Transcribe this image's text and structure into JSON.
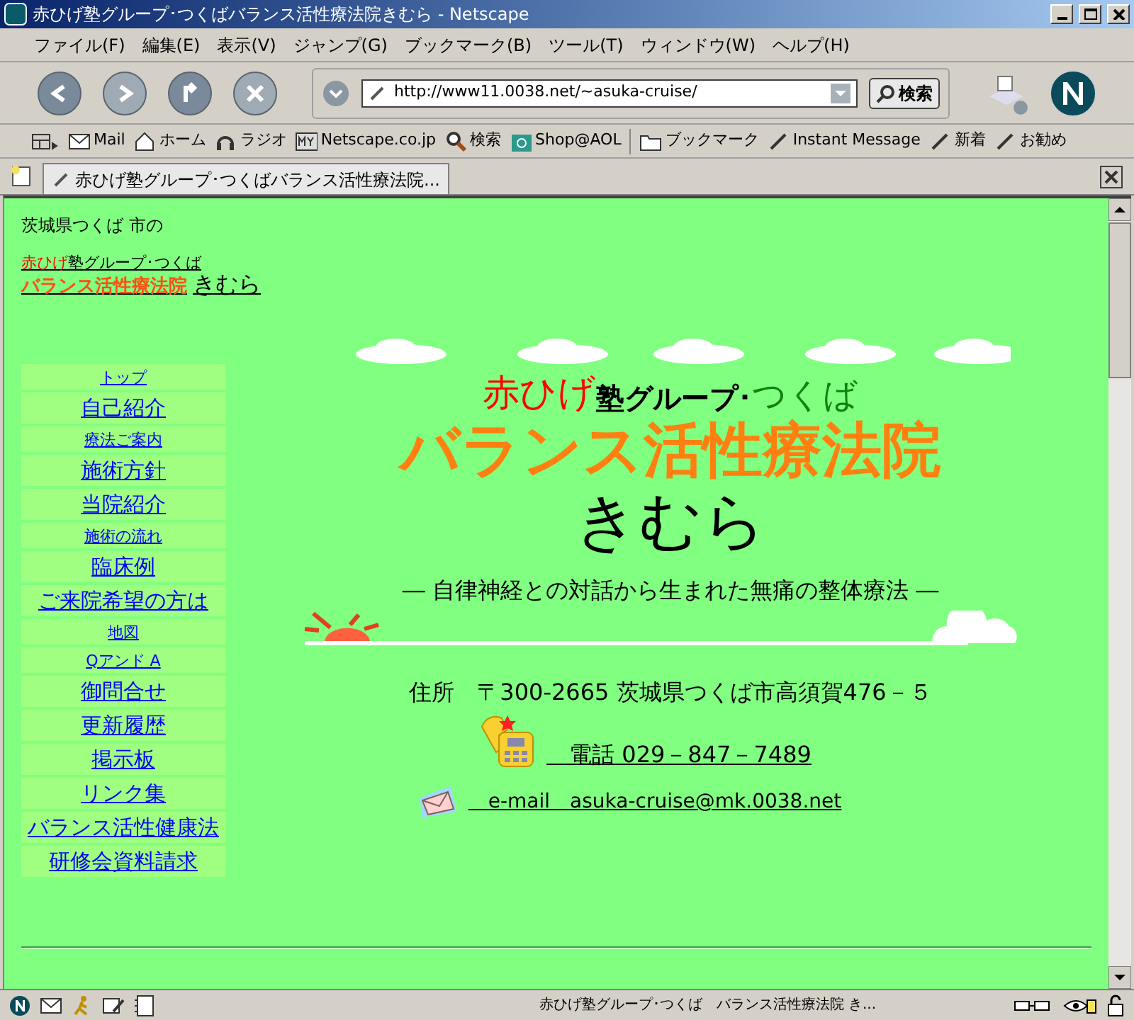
{
  "window": {
    "title": "赤ひげ塾グループ･つくばバランス活性療法院きむら - Netscape"
  },
  "menu": [
    "ファイル(F)",
    "編集(E)",
    "表示(V)",
    "ジャンプ(G)",
    "ブックマーク(B)",
    "ツール(T)",
    "ウィンドウ(W)",
    "ヘルプ(H)"
  ],
  "address": {
    "url": "http://www11.0038.net/~asuka-cruise/",
    "search_button": "検索"
  },
  "personal_toolbar": [
    {
      "kind": "mail",
      "label": "Mail"
    },
    {
      "kind": "home",
      "label": "ホーム"
    },
    {
      "kind": "radio",
      "label": "ラジオ"
    },
    {
      "kind": "my",
      "label": "Netscape.co.jp"
    },
    {
      "kind": "search",
      "label": "検索"
    },
    {
      "kind": "shop",
      "label": "Shop@AOL"
    },
    {
      "kind": "folder",
      "label": "ブックマーク"
    },
    {
      "kind": "bookmark",
      "label": "Instant Message"
    },
    {
      "kind": "bookmark",
      "label": "新着"
    },
    {
      "kind": "bookmark",
      "label": "お勧め"
    }
  ],
  "tab": {
    "title": "赤ひげ塾グループ･つくばバランス活性療法院...",
    "selected": true
  },
  "page": {
    "intro": "茨城県つくば 市の",
    "header_link": {
      "red": "赤ひげ",
      "black": "塾グループ･つくば",
      "orange": "バランス活性療法院",
      "name": "きむら"
    },
    "nav": [
      {
        "label": "トップ",
        "kind": "small"
      },
      {
        "label": "自己紹介",
        "kind": "large"
      },
      {
        "label": "療法ご案内",
        "kind": "small"
      },
      {
        "label": "施術方針",
        "kind": "large"
      },
      {
        "label": "当院紹介",
        "kind": "large"
      },
      {
        "label": "施術の流れ",
        "kind": "small"
      },
      {
        "label": "臨床例",
        "kind": "large"
      },
      {
        "label": "ご来院希望の方は",
        "kind": "large"
      },
      {
        "label": "地図",
        "kind": "small"
      },
      {
        "label": "Qアンド A",
        "kind": "small"
      },
      {
        "label": "御問合せ",
        "kind": "large"
      },
      {
        "label": "更新履歴",
        "kind": "large"
      },
      {
        "label": "掲示板",
        "kind": "large"
      },
      {
        "label": "リンク集",
        "kind": "large"
      },
      {
        "label": "バランス活性健康法",
        "kind": "large"
      },
      {
        "label": "研修会資料請求",
        "kind": "large"
      }
    ],
    "hero": {
      "red": "赤ひげ",
      "black": "塾グループ･",
      "green": "つくば",
      "title": "バランス活性療法院",
      "name": "きむら"
    },
    "tagline": "―  自律神経との対話から生まれた無痛の整体療法  ―",
    "address": "住所　〒300-2665  茨城県つくば市高須賀476－５",
    "phone": "　電話  029－847－7489",
    "email": "　e-mail　asuka-cruise@mk.0038.net"
  },
  "status_bar": {
    "text": "赤ひげ塾グループ･つくば　バランス活性療法院 き..."
  }
}
